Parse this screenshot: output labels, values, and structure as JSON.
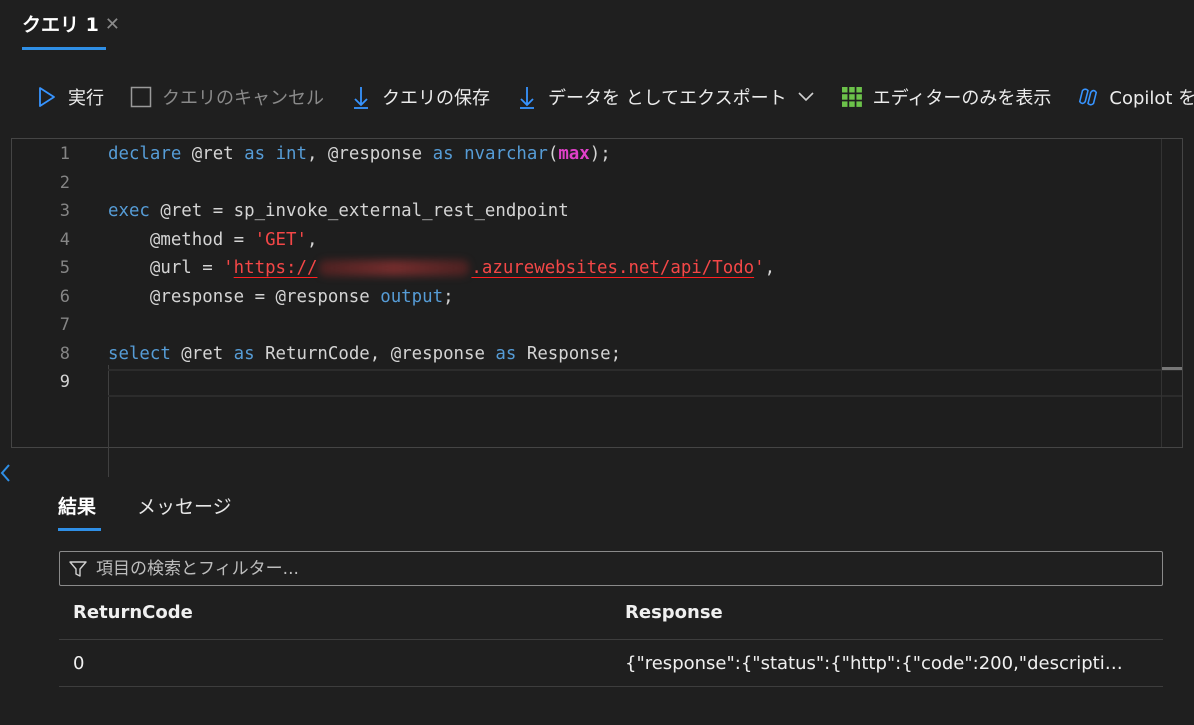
{
  "tab": {
    "title": "クエリ 1",
    "close_glyph": "✕"
  },
  "toolbar": {
    "run": "実行",
    "cancel": "クエリのキャンセル",
    "save": "クエリの保存",
    "export": "データを としてエクスポート",
    "editor_only": "エディターのみを表示",
    "copilot": "Copilot を開く"
  },
  "editor": {
    "line_numbers": [
      "1",
      "2",
      "3",
      "4",
      "5",
      "6",
      "7",
      "8",
      "9"
    ],
    "line1": {
      "kw1": "declare",
      "p1": " @ret ",
      "kw2": "as",
      "p2": " ",
      "kw3": "int",
      "p3": ", @response ",
      "kw4": "as",
      "p4": " ",
      "kw5": "nvarchar",
      "p5": "(",
      "mx": "max",
      "p6": ");"
    },
    "line3": {
      "kw1": "exec",
      "p1": " @ret = sp_invoke_external_rest_endpoint"
    },
    "line4": {
      "p1": "    @method = ",
      "str": "'GET'",
      "p2": ","
    },
    "line5": {
      "p1": "    @url = ",
      "q1": "'",
      "url1": "https://",
      "url2": ".azurewebsites.net/api/Todo",
      "q2": "'",
      "p2": ","
    },
    "line6": {
      "p1": "    @response = @response ",
      "kw1": "output",
      "p2": ";"
    },
    "line8": {
      "kw1": "select",
      "p1": " @ret ",
      "kw2": "as",
      "p2": " ReturnCode, @response ",
      "kw3": "as",
      "p3": " Response;"
    }
  },
  "results": {
    "tabs": [
      "結果",
      "メッセージ"
    ],
    "filter_placeholder": "項目の検索とフィルター...",
    "columns": [
      "ReturnCode",
      "Response"
    ],
    "rows": [
      {
        "ReturnCode": "0",
        "Response": "{\"response\":{\"status\":{\"http\":{\"code\":200,\"descripti…"
      }
    ]
  },
  "colors": {
    "accent": "#2f8fe6",
    "keyword": "#569cd6",
    "string": "#f44747",
    "max": "#e040c8",
    "background": "#1f1f1f"
  },
  "icons": [
    "play-icon",
    "checkbox-icon",
    "download-arrow-icon",
    "chevron-down-icon",
    "grid-icon",
    "copilot-icon",
    "filter-icon",
    "collapse-arrow-icon"
  ]
}
